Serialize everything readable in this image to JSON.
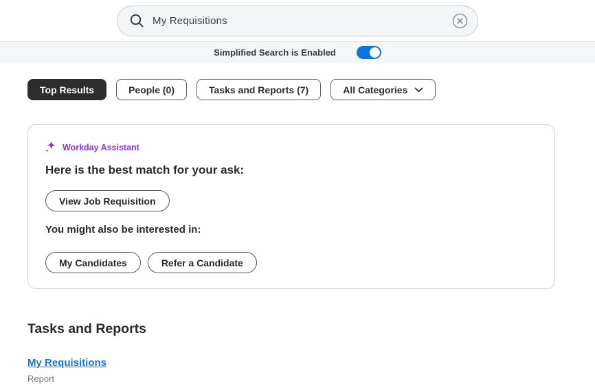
{
  "colors": {
    "accent_blue": "#0b75e1",
    "link_blue": "#1976d2",
    "assistant_purple": "#8b33e0",
    "selected_pill_bg": "#2d2d2d"
  },
  "search": {
    "value": "My Requisitions",
    "search_icon": "magnifier",
    "clear_icon": "circle-x"
  },
  "toggle_bar": {
    "label": "Simplified Search is Enabled",
    "enabled": true
  },
  "pills": [
    {
      "label": "Top Results",
      "selected": true
    },
    {
      "label": "People (0)",
      "selected": false
    },
    {
      "label": "Tasks and Reports (7)",
      "selected": false
    },
    {
      "label": "All Categories",
      "selected": false,
      "chevron_icon": "chevron-down"
    }
  ],
  "assistant": {
    "sparkle_icon": "sparkle",
    "title": "Workday Assistant",
    "best_match_heading": "Here is the best match for your ask:",
    "primary_action": "View Job Requisition",
    "also_heading": "You might also be interested in:",
    "secondary_actions": [
      "My Candidates",
      "Refer a Candidate"
    ]
  },
  "results": {
    "heading": "Tasks and Reports",
    "items": [
      {
        "title": "My Requisitions",
        "type": "Report"
      }
    ]
  }
}
